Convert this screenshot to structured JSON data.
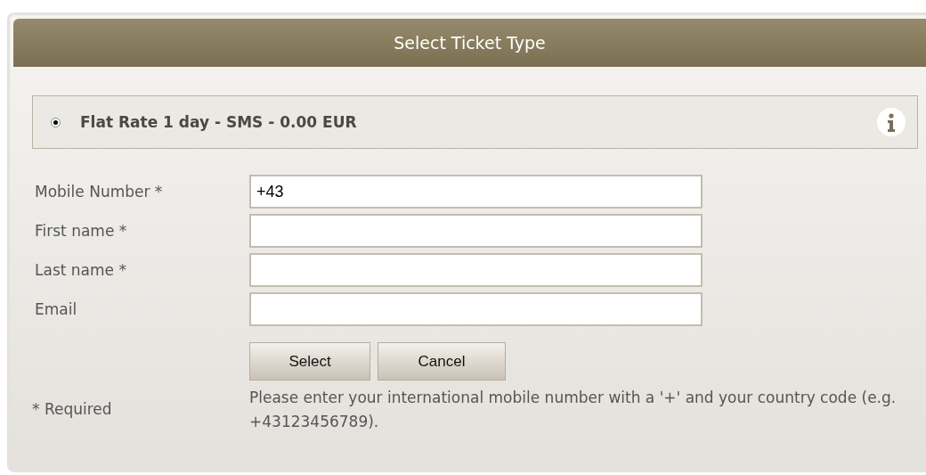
{
  "header": {
    "title": "Select Ticket Type"
  },
  "ticket_options": [
    {
      "label": "Flat Rate 1 day - SMS - 0.00 EUR",
      "selected": true
    }
  ],
  "fields": [
    {
      "label": "Mobile Number *",
      "value": "+43"
    },
    {
      "label": "First name *"
    },
    {
      "label": "Last name *"
    },
    {
      "label": "Email"
    }
  ],
  "buttons": [
    "Select",
    "Cancel"
  ],
  "required_note": "* Required",
  "help_text": "Please enter your international mobile number with a '+' and your country code (e.g. +43123456789)."
}
